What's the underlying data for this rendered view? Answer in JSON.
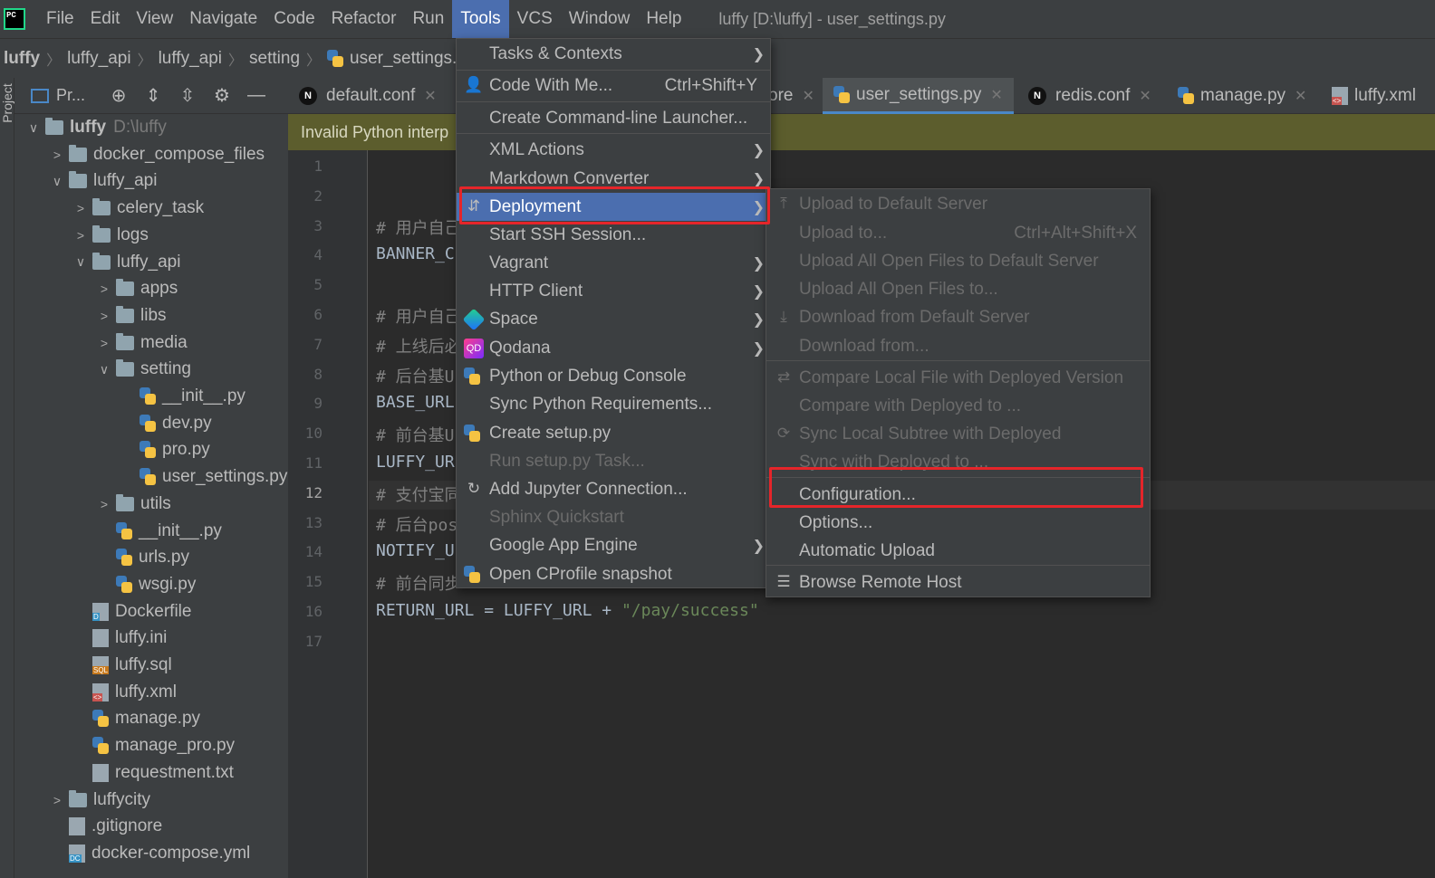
{
  "menubar": {
    "logo": "PC",
    "items": [
      "File",
      "Edit",
      "View",
      "Navigate",
      "Code",
      "Refactor",
      "Run",
      "Tools",
      "VCS",
      "Window",
      "Help"
    ],
    "active": "Tools",
    "title": "luffy [D:\\luffy] - user_settings.py"
  },
  "breadcrumb": [
    "luffy",
    "luffy_api",
    "luffy_api",
    "setting",
    "user_settings.py"
  ],
  "project_panel": {
    "vertical_tab": "Project",
    "toolbar_label": "Pr...",
    "tree": [
      {
        "label": "luffy",
        "extra": "D:\\luffy",
        "arrow": "∨",
        "kind": "folder"
      },
      {
        "label": "docker_compose_files",
        "arrow": ">",
        "kind": "folder"
      },
      {
        "label": "luffy_api",
        "arrow": "∨",
        "kind": "folder"
      },
      {
        "label": "celery_task",
        "arrow": ">",
        "kind": "folder"
      },
      {
        "label": "logs",
        "arrow": ">",
        "kind": "folder"
      },
      {
        "label": "luffy_api",
        "arrow": "∨",
        "kind": "folder"
      },
      {
        "label": "apps",
        "arrow": ">",
        "kind": "folder"
      },
      {
        "label": "libs",
        "arrow": ">",
        "kind": "folder"
      },
      {
        "label": "media",
        "arrow": ">",
        "kind": "folder"
      },
      {
        "label": "setting",
        "arrow": "∨",
        "kind": "folder"
      },
      {
        "label": "__init__.py",
        "arrow": "",
        "kind": "py"
      },
      {
        "label": "dev.py",
        "arrow": "",
        "kind": "py"
      },
      {
        "label": "pro.py",
        "arrow": "",
        "kind": "py"
      },
      {
        "label": "user_settings.py",
        "arrow": "",
        "kind": "py"
      },
      {
        "label": "utils",
        "arrow": ">",
        "kind": "folder"
      },
      {
        "label": "__init__.py",
        "arrow": "",
        "kind": "py"
      },
      {
        "label": "urls.py",
        "arrow": "",
        "kind": "py"
      },
      {
        "label": "wsgi.py",
        "arrow": "",
        "kind": "py"
      },
      {
        "label": "Dockerfile",
        "arrow": "",
        "kind": "dk"
      },
      {
        "label": "luffy.ini",
        "arrow": "",
        "kind": "ini"
      },
      {
        "label": "luffy.sql",
        "arrow": "",
        "kind": "sql"
      },
      {
        "label": "luffy.xml",
        "arrow": "",
        "kind": "xml"
      },
      {
        "label": "manage.py",
        "arrow": "",
        "kind": "py"
      },
      {
        "label": "manage_pro.py",
        "arrow": "",
        "kind": "py"
      },
      {
        "label": "requestment.txt",
        "arrow": "",
        "kind": "txt"
      },
      {
        "label": "luffycity",
        "arrow": ">",
        "kind": "folder"
      },
      {
        "label": ".gitignore",
        "arrow": "",
        "kind": "txt"
      },
      {
        "label": "docker-compose.yml",
        "arrow": "",
        "kind": "dc"
      }
    ]
  },
  "editor": {
    "tabs": [
      "default.conf",
      "ore",
      "user_settings.py",
      "redis.conf",
      "manage.py",
      "luffy.xml"
    ],
    "active_tab": "user_settings.py",
    "warning": "Invalid Python interp",
    "line_numbers": [
      "1",
      "2",
      "3",
      "4",
      "5",
      "6",
      "7",
      "8",
      "9",
      "10",
      "11",
      "12",
      "13",
      "14",
      "15",
      "16",
      "17"
    ],
    "current_line": "12",
    "lines": [
      "",
      "",
      "# 用户自己",
      "BANNER_C",
      "",
      "# 用户自己",
      "# 上线后必",
      "# 后台基U",
      "BASE_URL",
      "# 前台基U",
      "LUFFY_UR",
      "# 支付宝同",
      "# 后台pos",
      "NOTIFY_U",
      "# 前台同步",
      "RETURN_URL = LUFFY_URL + ",
      ""
    ],
    "line16_string": "\"/pay/success\""
  },
  "tools_menu": [
    {
      "label": "Tasks & Contexts",
      "sub": true
    },
    {
      "label": "Code With Me...",
      "shortcut": "Ctrl+Shift+Y",
      "icon": "person"
    },
    {
      "label": "Create Command-line Launcher..."
    },
    {
      "label": "XML Actions",
      "sub": true
    },
    {
      "label": "Markdown Converter",
      "sub": true
    },
    {
      "label": "Deployment",
      "sub": true,
      "selected": true,
      "icon": "deploy"
    },
    {
      "label": "Start SSH Session..."
    },
    {
      "label": "Vagrant",
      "sub": true
    },
    {
      "label": "HTTP Client",
      "sub": true
    },
    {
      "label": "Space",
      "sub": true,
      "icon": "space"
    },
    {
      "label": "Qodana",
      "sub": true,
      "icon": "qodana"
    },
    {
      "label": "Python or Debug Console",
      "icon": "python"
    },
    {
      "label": "Sync Python Requirements..."
    },
    {
      "label": "Create setup.py",
      "icon": "python"
    },
    {
      "label": "Run setup.py Task...",
      "disabled": true
    },
    {
      "label": "Add Jupyter Connection...",
      "icon": "jupyter"
    },
    {
      "label": "Sphinx Quickstart",
      "disabled": true
    },
    {
      "label": "Google App Engine",
      "sub": true
    },
    {
      "label": "Open CProfile snapshot",
      "icon": "python"
    }
  ],
  "deployment_menu": [
    {
      "label": "Upload to Default Server",
      "disabled": true,
      "icon": "⤒"
    },
    {
      "label": "Upload to...",
      "shortcut": "Ctrl+Alt+Shift+X",
      "disabled": true
    },
    {
      "label": "Upload All Open Files to Default Server",
      "disabled": true
    },
    {
      "label": "Upload All Open Files to...",
      "disabled": true
    },
    {
      "label": "Download from Default Server",
      "disabled": true,
      "icon": "⤓"
    },
    {
      "label": "Download from...",
      "disabled": true
    },
    {
      "label": "Compare Local File with Deployed Version",
      "disabled": true,
      "icon": "⇄"
    },
    {
      "label": "Compare with Deployed to ...",
      "disabled": true
    },
    {
      "label": "Sync Local Subtree with Deployed",
      "disabled": true,
      "icon": "⟳"
    },
    {
      "label": "Sync with Deployed to ...",
      "disabled": true
    },
    {
      "label": "Configuration..."
    },
    {
      "label": "Options..."
    },
    {
      "label": "Automatic Upload"
    },
    {
      "label": "Browse Remote Host",
      "icon": "☰"
    }
  ],
  "colors": {
    "highlight": "#e5252a",
    "selection": "#4b6eaf"
  }
}
